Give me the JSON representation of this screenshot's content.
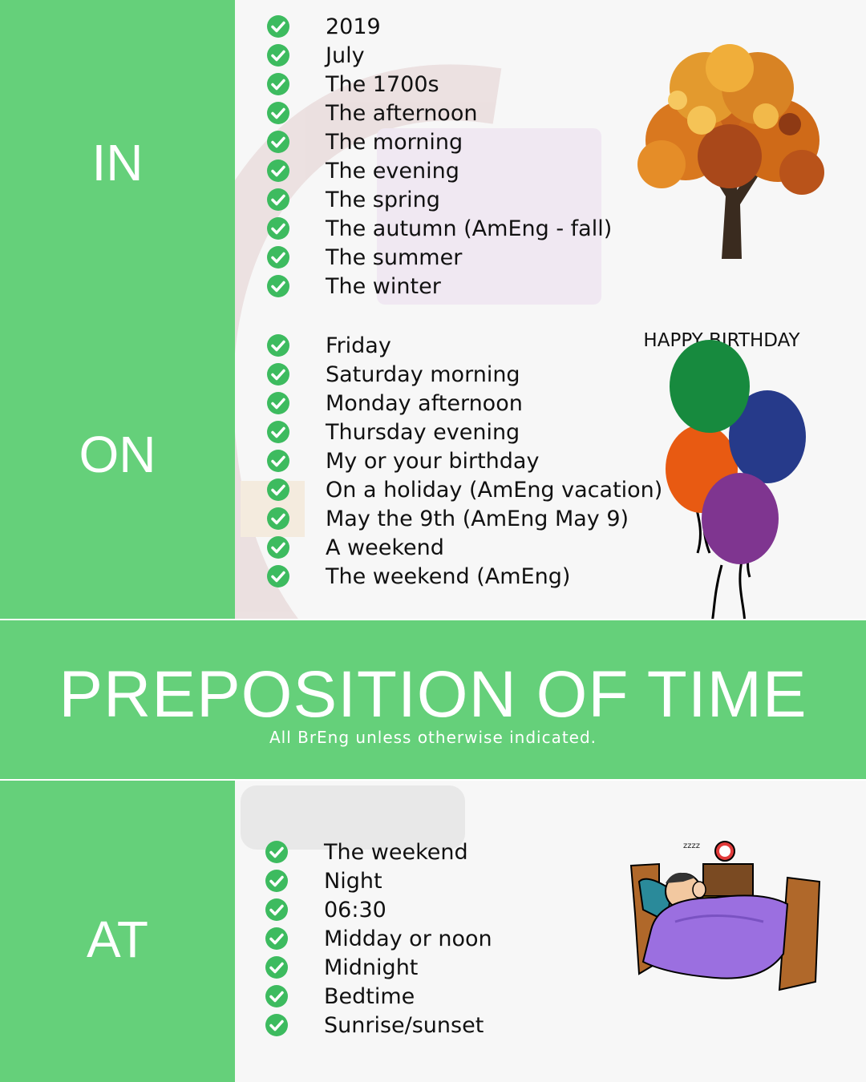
{
  "title": "PREPOSITION OF TIME",
  "subtitle": "All BrEng unless otherwise indicated.",
  "colors": {
    "accent": "#65d07a",
    "check": "#3dbb5f",
    "text": "#111111"
  },
  "check_icon": "check-circle-icon",
  "sections": [
    {
      "label": "IN",
      "items": [
        "2019",
        "July",
        "The 1700s",
        "The afternoon",
        "The morning",
        "The evening",
        "The spring",
        "The autumn (AmEng - fall)",
        "The summer",
        "The winter"
      ]
    },
    {
      "label": "ON",
      "items": [
        "Friday",
        "Saturday morning",
        "Monday afternoon",
        "Thursday evening",
        "My or your birthday",
        "On a holiday (AmEng vacation)",
        "May the 9th (AmEng May 9)",
        "A weekend",
        "The weekend (AmEng)"
      ]
    },
    {
      "label": "AT",
      "items": [
        "The weekend",
        "Night",
        "06:30",
        "Midday or noon",
        "Midnight",
        "Bedtime",
        "Sunrise/sunset"
      ]
    }
  ],
  "illustrations": {
    "birthday_text": "HAPPY BIRTHDAY",
    "tree": "autumn-tree-illustration",
    "balloons": "birthday-balloons-illustration",
    "sleeper": "sleeping-person-illustration"
  }
}
